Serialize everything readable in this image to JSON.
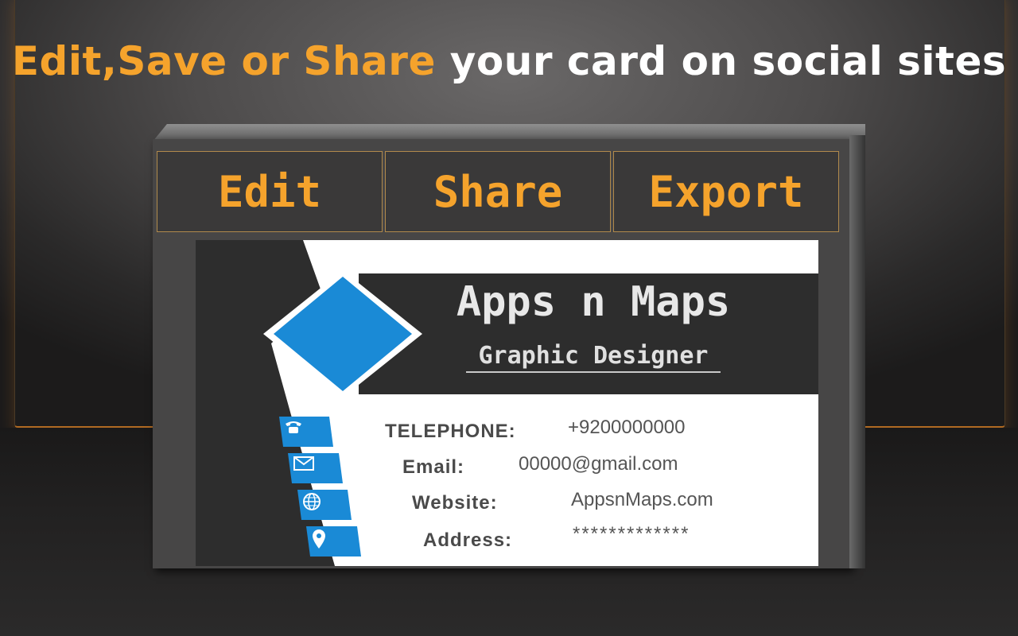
{
  "headline": {
    "accent": "Edit,Save or Share",
    "rest": "your card on social sites"
  },
  "tabs": [
    "Edit",
    "Share",
    "Export"
  ],
  "card": {
    "name": "Apps n Maps",
    "role": "Graphic Designer",
    "rows": [
      {
        "label": "TELEPHONE:",
        "value": "+9200000000",
        "icon": "phone-icon"
      },
      {
        "label": "Email:",
        "value": "00000@gmail.com",
        "icon": "mail-icon"
      },
      {
        "label": "Website:",
        "value": "AppsnMaps.com",
        "icon": "globe-icon"
      },
      {
        "label": "Address:",
        "value": "*************",
        "icon": "location-pin-icon"
      }
    ]
  },
  "colors": {
    "accent": "#f5a32c",
    "card_blue": "#1a8ad6",
    "card_dark": "#2d2d2d"
  }
}
